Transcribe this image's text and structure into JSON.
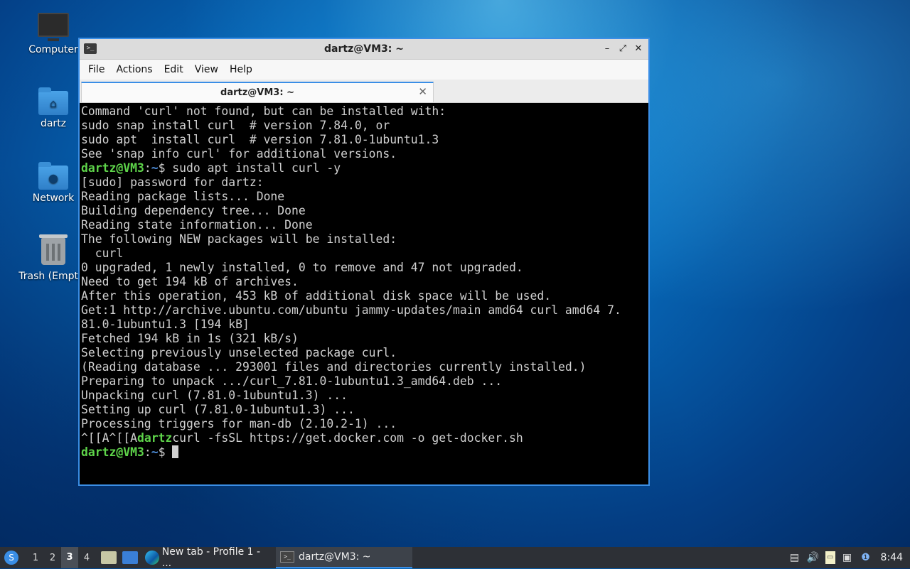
{
  "desktop": {
    "icons": [
      {
        "label": "Computer",
        "icon": "monitor-icon"
      },
      {
        "label": "dartz",
        "icon": "home-folder-icon"
      },
      {
        "label": "Network",
        "icon": "network-folder-icon"
      },
      {
        "label": "Trash (Empty)",
        "icon": "trash-icon"
      }
    ]
  },
  "window": {
    "title": "dartz@VM3: ~",
    "menu": [
      "File",
      "Actions",
      "Edit",
      "View",
      "Help"
    ],
    "tab_label": "dartz@VM3: ~",
    "controls": {
      "minimize": "–",
      "maximize": "⤢",
      "close": "✕"
    }
  },
  "terminal": {
    "prompt_user": "dartz@VM3",
    "prompt_path": "~",
    "prompt_symbol": "$",
    "lines": [
      "Command 'curl' not found, but can be installed with:",
      "sudo snap install curl  # version 7.84.0, or",
      "sudo apt  install curl  # version 7.81.0-1ubuntu1.3",
      "See 'snap info curl' for additional versions."
    ],
    "cmd1": " sudo apt install curl -y",
    "lines2": [
      "[sudo] password for dartz:",
      "Reading package lists... Done",
      "Building dependency tree... Done",
      "Reading state information... Done",
      "The following NEW packages will be installed:",
      "  curl",
      "0 upgraded, 1 newly installed, 0 to remove and 47 not upgraded.",
      "Need to get 194 kB of archives.",
      "After this operation, 453 kB of additional disk space will be used.",
      "Get:1 http://archive.ubuntu.com/ubuntu jammy-updates/main amd64 curl amd64 7.",
      "81.0-1ubuntu1.3 [194 kB]",
      "Fetched 194 kB in 1s (321 kB/s)",
      "Selecting previously unselected package curl.",
      "(Reading database ... 293001 files and directories currently installed.)",
      "Preparing to unpack .../curl_7.81.0-1ubuntu1.3_amd64.deb ...",
      "Unpacking curl (7.81.0-1ubuntu1.3) ...",
      "Setting up curl (7.81.0-1ubuntu1.3) ...",
      "Processing triggers for man-db (2.10.2-1) ..."
    ],
    "garbled_prefix": "^[[A^[[A",
    "garbled_user": "dartz",
    "garbled_cmd": "curl -fsSL https://get.docker.com -o get-docker.sh"
  },
  "taskbar": {
    "workspaces": [
      "1",
      "2",
      "3",
      "4"
    ],
    "active_workspace": "3",
    "tasks": [
      {
        "label": "New tab - Profile 1 - ...",
        "icon": "edge-icon"
      },
      {
        "label": "dartz@VM3: ~",
        "icon": "terminal-icon"
      }
    ],
    "clock": "8:44"
  },
  "colors": {
    "accent": "#3a8ee6",
    "prompt_user": "#5ed44a",
    "prompt_path": "#4f8fdc"
  }
}
